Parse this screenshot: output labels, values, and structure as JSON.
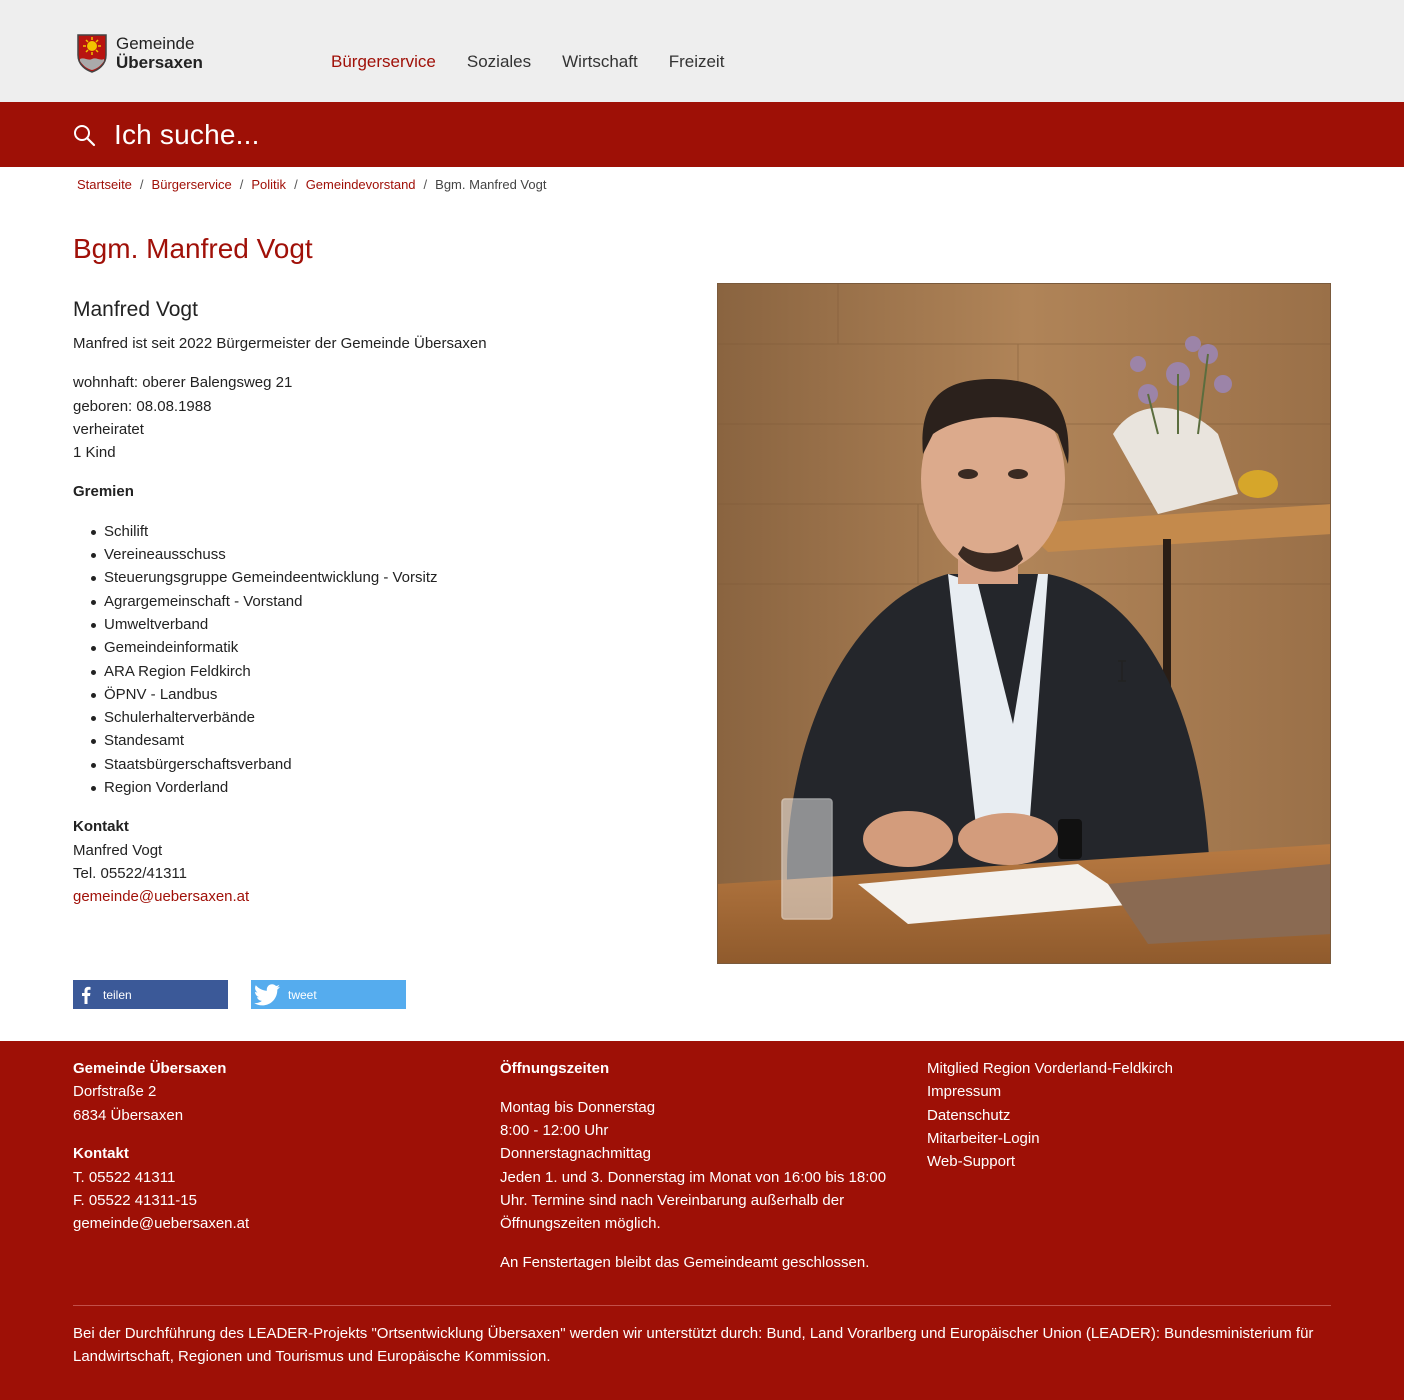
{
  "header": {
    "logo_line1": "Gemeinde",
    "logo_line2": "Übersaxen",
    "nav": [
      {
        "label": "Bürgerservice",
        "active": true
      },
      {
        "label": "Soziales"
      },
      {
        "label": "Wirtschaft"
      },
      {
        "label": "Freizeit"
      }
    ]
  },
  "search": {
    "placeholder": "Ich suche..."
  },
  "breadcrumb": {
    "items": [
      "Startseite",
      "Bürgerservice",
      "Politik",
      "Gemeindevorstand"
    ],
    "current": "Bgm. Manfred Vogt",
    "separator": "/"
  },
  "page": {
    "title": "Bgm. Manfred Vogt",
    "name": "Manfred Vogt",
    "intro": "Manfred ist seit 2022 Bürgermeister der Gemeinde Übersaxen",
    "facts": [
      "wohnhaft: oberer Balengsweg 21",
      "geboren: 08.08.1988",
      "verheiratet",
      "1 Kind"
    ],
    "gremien_heading": "Gremien",
    "gremien": [
      "Schilift",
      "Vereineausschuss",
      "Steuerungsgruppe Gemeindeentwicklung - Vorsitz",
      "Agrargemeinschaft - Vorstand",
      "Umweltverband",
      "Gemeindeinformatik",
      "ARA Region Feldkirch",
      "ÖPNV - Landbus",
      "Schulerhalterverbände",
      "Standesamt",
      "Staatsbürgerschaftsverband",
      "Region Vorderland"
    ],
    "kontakt_heading": "Kontakt",
    "kontakt_name": "Manfred Vogt",
    "kontakt_tel": "Tel. 05522/41311",
    "kontakt_email": "gemeinde@uebersaxen.at"
  },
  "share": {
    "facebook_label": "teilen",
    "twitter_label": "tweet"
  },
  "footer": {
    "org_name": "Gemeinde Übersaxen",
    "address1": "Dorfstraße 2",
    "address2": "6834 Übersaxen",
    "kontakt_heading": "Kontakt",
    "phone": "T. 05522 41311",
    "fax": "F. 05522 41311-15",
    "email": "gemeinde@uebersaxen.at",
    "hours_heading": "Öffnungszeiten",
    "hours_days": "Montag bis Donnerstag",
    "hours_time": "8:00 - 12:00 Uhr",
    "hours_afternoon": "Donnerstagnachmittag",
    "hours_note": "Jeden 1. und 3. Donnerstag im Monat von 16:00 bis 18:00 Uhr. Termine sind nach Vereinbarung außerhalb der Öffnungszeiten möglich.",
    "hours_closed": "An Fenstertagen bleibt das Gemeindeamt geschlossen.",
    "links": [
      "Mitglied Region Vorderland-Feldkirch",
      "Impressum",
      "Datenschutz",
      "Mitarbeiter-Login",
      "Web-Support"
    ],
    "leader_note": "Bei der Durchführung des LEADER-Projekts \"Ortsentwicklung Übersaxen\" werden wir unterstützt durch: Bund, Land Vorarlberg und Europäischer Union (LEADER): Bundesministerium für Landwirtschaft, Regionen und Tourismus und Europäische Kommission."
  },
  "colors": {
    "brand_red": "#9e1006",
    "link_red": "#a01008",
    "facebook": "#3b5998",
    "twitter": "#55acee",
    "header_bg": "#eeeeee"
  },
  "icons": [
    "crest-logo",
    "search-icon",
    "facebook-icon",
    "twitter-icon",
    "text-cursor-icon"
  ]
}
